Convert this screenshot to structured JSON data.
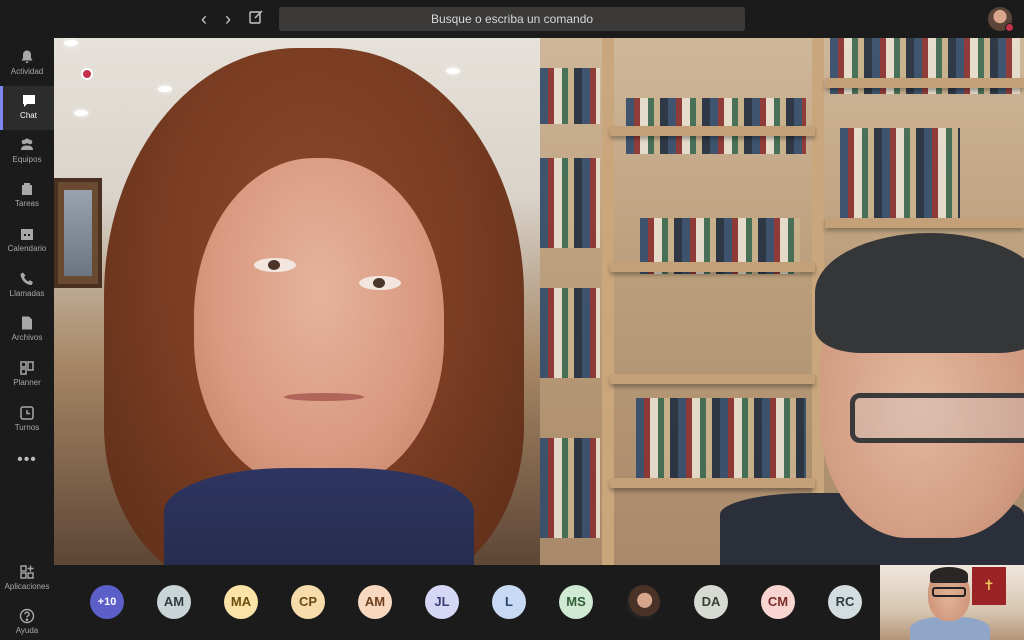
{
  "topbar": {
    "back_icon": "‹",
    "forward_icon": "›",
    "compose_icon": "compose-icon",
    "search_placeholder": "Busque o escriba un comando"
  },
  "rail": {
    "items": [
      {
        "label": "Actividad",
        "icon": "bell-icon"
      },
      {
        "label": "Chat",
        "icon": "chat-icon"
      },
      {
        "label": "Equipos",
        "icon": "teams-icon"
      },
      {
        "label": "Tareas",
        "icon": "tasks-icon"
      },
      {
        "label": "Calendario",
        "icon": "calendar-icon"
      },
      {
        "label": "Llamadas",
        "icon": "phone-icon"
      },
      {
        "label": "Archivos",
        "icon": "file-icon"
      },
      {
        "label": "Planner",
        "icon": "planner-icon"
      },
      {
        "label": "Turnos",
        "icon": "clock-icon"
      }
    ],
    "more": "•••",
    "bottom": [
      {
        "label": "Aplicaciones",
        "icon": "apps-icon"
      },
      {
        "label": "Ayuda",
        "icon": "help-icon"
      }
    ],
    "active_item": "Chat",
    "accent": "#7f85f5"
  },
  "participants": {
    "more_count": "+10",
    "chips": [
      "AM",
      "MA",
      "CP",
      "AM",
      "JL",
      "L",
      "MS",
      "",
      "DA",
      "CM",
      "RC"
    ],
    "chip_colors": [
      {
        "bg": "#c9d4d6",
        "fg": "#2f3b3d"
      },
      {
        "bg": "#fbe3a8",
        "fg": "#6b4d0f"
      },
      {
        "bg": "#f6dcaa",
        "fg": "#6b4a14"
      },
      {
        "bg": "#f8d9bf",
        "fg": "#6d3e1c"
      },
      {
        "bg": "#d6d7f4",
        "fg": "#3e3f7a"
      },
      {
        "bg": "#c7d9f3",
        "fg": "#27466e"
      },
      {
        "bg": "#cfe9d2",
        "fg": "#2f5d35"
      },
      {
        "bg": "photo",
        "fg": ""
      },
      {
        "bg": "#d7dad2",
        "fg": "#3b4035"
      },
      {
        "bg": "#f9d5d2",
        "fg": "#7a2e2a"
      },
      {
        "bg": "#d3dde0",
        "fg": "#2f3d42"
      }
    ]
  },
  "colors": {
    "recording": "#c4314b",
    "brand": "#5b5fc7"
  }
}
